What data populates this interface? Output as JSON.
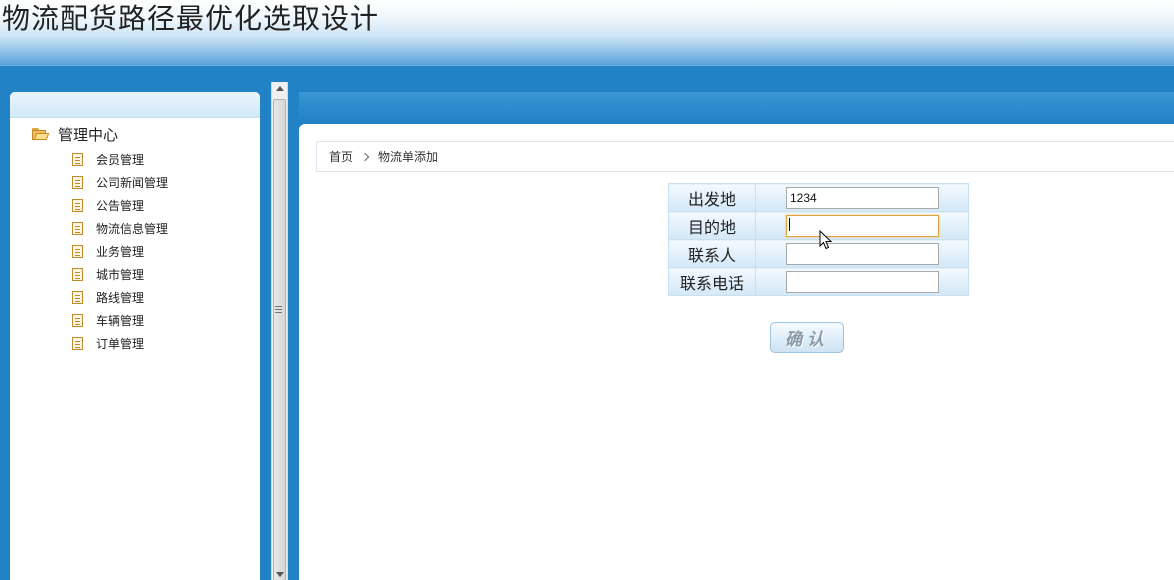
{
  "header": {
    "title": "物流配货路径最优化选取设计"
  },
  "sidebar": {
    "root": {
      "label": "管理中心",
      "icon": "folder-open-icon"
    },
    "items": [
      {
        "label": "会员管理",
        "icon": "document-icon"
      },
      {
        "label": "公司新闻管理",
        "icon": "document-icon"
      },
      {
        "label": "公告管理",
        "icon": "document-icon"
      },
      {
        "label": "物流信息管理",
        "icon": "document-icon"
      },
      {
        "label": "业务管理",
        "icon": "document-icon"
      },
      {
        "label": "城市管理",
        "icon": "document-icon"
      },
      {
        "label": "路线管理",
        "icon": "document-icon"
      },
      {
        "label": "车辆管理",
        "icon": "document-icon"
      },
      {
        "label": "订单管理",
        "icon": "document-icon"
      }
    ]
  },
  "breadcrumb": {
    "home": "首页",
    "current": "物流单添加"
  },
  "form": {
    "fields": [
      {
        "label": "出发地",
        "value": "1234"
      },
      {
        "label": "目的地",
        "value": ""
      },
      {
        "label": "联系人",
        "value": ""
      },
      {
        "label": "联系电话",
        "value": ""
      }
    ],
    "submit_label": "确认"
  },
  "colors": {
    "band": "#2182c6",
    "accent": "#1f7fc2",
    "focus_border": "#e0a340"
  }
}
